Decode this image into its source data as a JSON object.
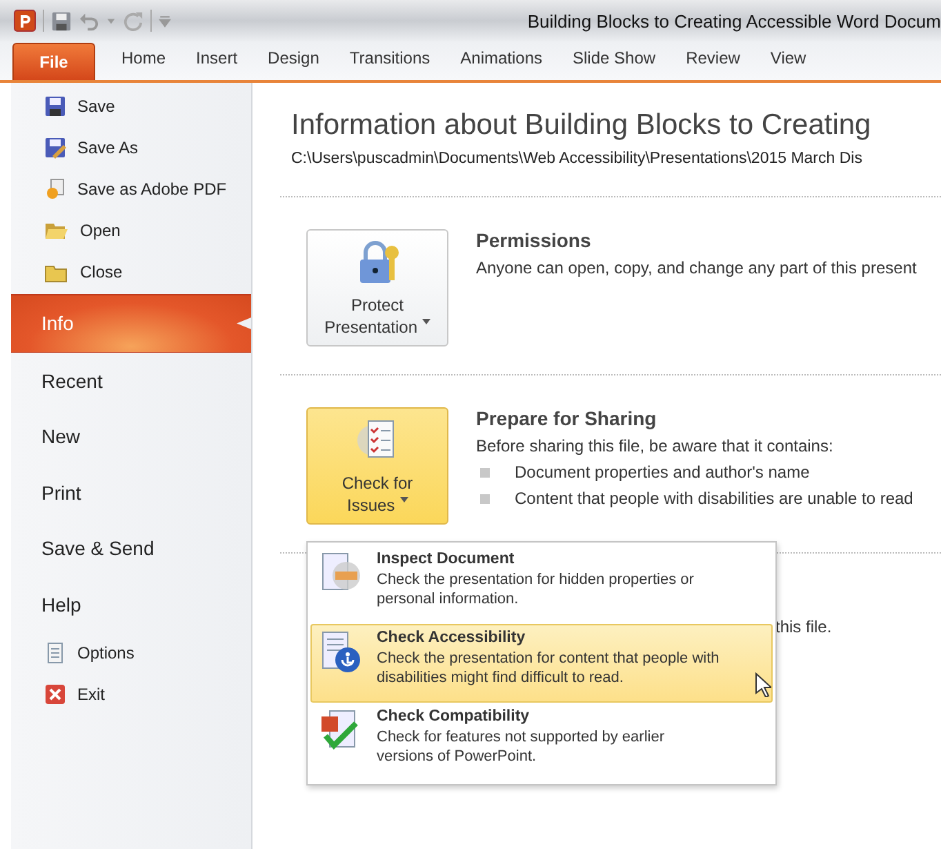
{
  "window": {
    "title": "Building Blocks to Creating Accessible Word Docum"
  },
  "file_tab": {
    "label": "File"
  },
  "ribbon_tabs": [
    {
      "label": "Home",
      "selected": false
    },
    {
      "label": "Insert",
      "selected": false
    },
    {
      "label": "Design",
      "selected": false
    },
    {
      "label": "Transitions",
      "selected": false
    },
    {
      "label": "Animations",
      "selected": false
    },
    {
      "label": "Slide Show",
      "selected": false
    },
    {
      "label": "Review",
      "selected": false
    },
    {
      "label": "View",
      "selected": false
    }
  ],
  "sidebar": {
    "items": [
      {
        "label": "Save",
        "kind": "command",
        "selected": false
      },
      {
        "label": "Save As",
        "kind": "command",
        "selected": false
      },
      {
        "label": "Save as Adobe PDF",
        "kind": "command",
        "selected": false
      },
      {
        "label": "Open",
        "kind": "command",
        "selected": false
      },
      {
        "label": "Close",
        "kind": "command",
        "selected": false
      },
      {
        "label": "Info",
        "kind": "tab",
        "selected": true
      },
      {
        "label": "Recent",
        "kind": "tab",
        "selected": false
      },
      {
        "label": "New",
        "kind": "tab",
        "selected": false
      },
      {
        "label": "Print",
        "kind": "tab",
        "selected": false
      },
      {
        "label": "Save & Send",
        "kind": "tab",
        "selected": false
      },
      {
        "label": "Help",
        "kind": "tab",
        "selected": false
      },
      {
        "label": "Options",
        "kind": "command",
        "selected": false
      },
      {
        "label": "Exit",
        "kind": "command",
        "selected": false
      }
    ]
  },
  "info": {
    "heading": "Information about Building Blocks to Creating",
    "path": "C:\\Users\\puscadmin\\Documents\\Web Accessibility\\Presentations\\2015 March Dis",
    "sections": [
      {
        "button": {
          "line1": "Protect",
          "line2": "Presentation",
          "highlighted": false
        },
        "title": "Permissions",
        "description": "Anyone can open, copy, and change any part of this present"
      },
      {
        "button": {
          "line1": "Check for",
          "line2": "Issues",
          "highlighted": true
        },
        "title": "Prepare for Sharing",
        "description": "Before sharing this file, be aware that it contains:",
        "bullets": [
          "Document properties and author's name",
          "Content that people with disabilities are unable to read"
        ]
      }
    ],
    "partial_section": {
      "description": "this file."
    }
  },
  "dropdown": {
    "items": [
      {
        "title": "Inspect Document",
        "description": "Check the presentation for hidden properties or personal information.",
        "selected": false
      },
      {
        "title": "Check Accessibility",
        "description": "Check the presentation for content that people with disabilities might find difficult to read.",
        "selected": true
      },
      {
        "title": "Check Compatibility",
        "description": "Check for features not supported by earlier versions of PowerPoint.",
        "selected": false
      }
    ]
  }
}
